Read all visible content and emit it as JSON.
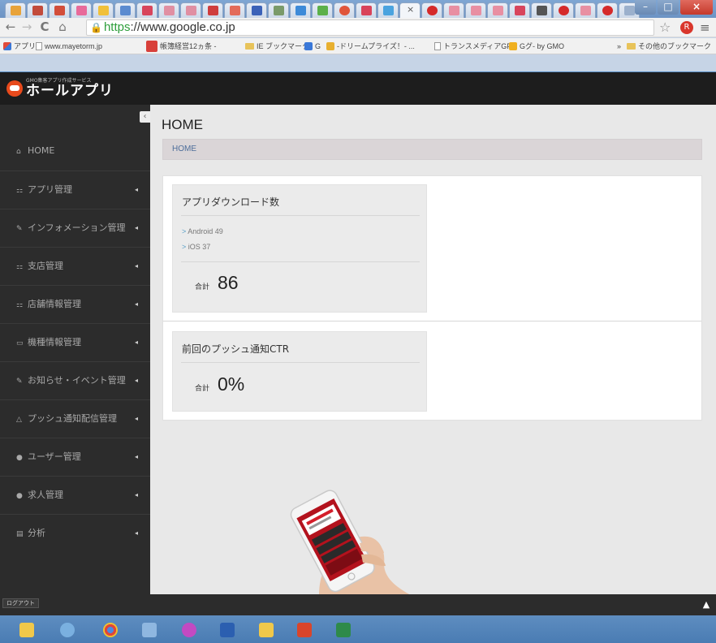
{
  "browser": {
    "url_scheme": "https",
    "url_rest": "://www.google.co.jp",
    "tab_close": "×",
    "win_minimize": "–",
    "win_maximize": "□",
    "win_close": "×",
    "bookmarks": [
      {
        "label": "アプリ",
        "icon": "apps-icon"
      },
      {
        "label": "www.mayetorm.jp",
        "icon": "page-icon"
      },
      {
        "label": "帳簿経営12ヵ条 -",
        "icon": "site-icon"
      },
      {
        "label": "IE ブックマーク",
        "icon": "folder-icon"
      },
      {
        "label": "G",
        "icon": "site-icon"
      },
      {
        "label": "-ドリームプライズ！- ...",
        "icon": "site-icon"
      },
      {
        "label": "トランスメディアGP",
        "icon": "page-icon"
      },
      {
        "label": "Gグ- by GMO",
        "icon": "site-icon"
      },
      {
        "label": "»",
        "icon": ""
      },
      {
        "label": "その他のブックマーク",
        "icon": "folder-icon"
      }
    ]
  },
  "app": {
    "logo_sub": "GMO集客アプリ作成サービス",
    "logo_title": "ホールアプリ"
  },
  "sidebar": {
    "collapse": "‹",
    "items": [
      {
        "label": "HOME",
        "icon": "home-icon",
        "glyph": "⌂",
        "caret": ""
      },
      {
        "label": "アプリ管理",
        "icon": "sitemap-icon",
        "glyph": "⚏",
        "caret": "◂"
      },
      {
        "label": "インフォメーション管理",
        "icon": "edit-icon",
        "glyph": "✎",
        "caret": "◂"
      },
      {
        "label": "支店管理",
        "icon": "sitemap-icon",
        "glyph": "⚏",
        "caret": "◂"
      },
      {
        "label": "店舗情報管理",
        "icon": "sitemap-icon",
        "glyph": "⚏",
        "caret": "◂"
      },
      {
        "label": "機種情報管理",
        "icon": "drive-icon",
        "glyph": "▭",
        "caret": "◂"
      },
      {
        "label": "お知らせ・イベント管理",
        "icon": "pencil-icon",
        "glyph": "✎",
        "caret": "◂"
      },
      {
        "label": "プッシュ通知配信管理",
        "icon": "bell-icon",
        "glyph": "△",
        "caret": "◂"
      },
      {
        "label": "ユーザー管理",
        "icon": "user-icon",
        "glyph": "●",
        "caret": "◂"
      },
      {
        "label": "求人管理",
        "icon": "comment-icon",
        "glyph": "●",
        "caret": "◂"
      },
      {
        "label": "分析",
        "icon": "chart-icon",
        "glyph": "▤",
        "caret": "◂"
      }
    ],
    "logout": "ログアウト"
  },
  "main": {
    "title": "HOME",
    "breadcrumb": "HOME",
    "downloads": {
      "title": "アプリダウンロード数",
      "android": "Android 49",
      "ios": "iOS 37",
      "total_label": "合計",
      "total_value": "86"
    },
    "push": {
      "title": "前回のプッシュ通知CTR",
      "total_label": "合計",
      "total_value": "0%"
    }
  },
  "footer": {
    "to_top": "▲"
  }
}
